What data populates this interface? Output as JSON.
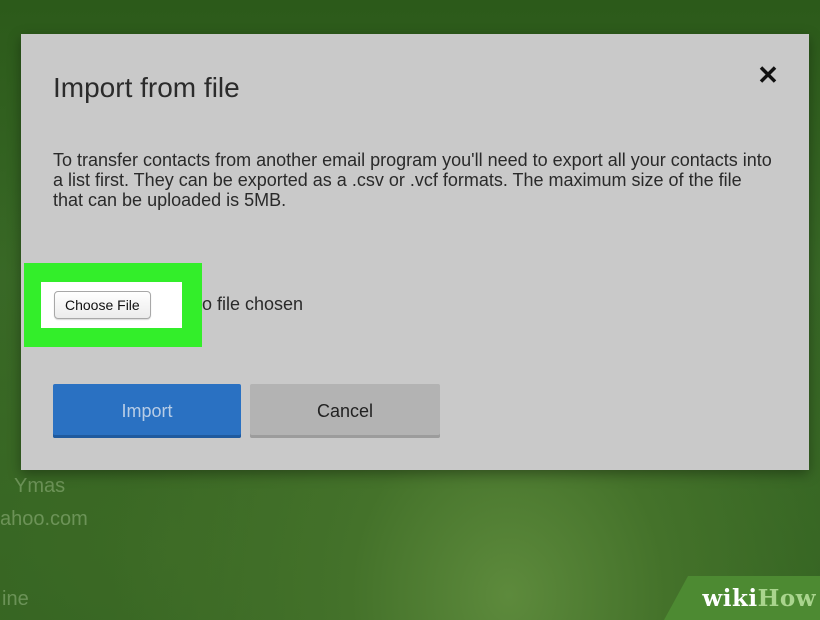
{
  "background": {
    "faint_lines": [
      "Ymas",
      "ahoo.com",
      "ine"
    ]
  },
  "watermark": {
    "part1": "wiki",
    "part2": "How"
  },
  "dialog": {
    "title": "Import from file",
    "close_icon": "close-icon",
    "close_glyph": "✕",
    "description": "To transfer contacts from another email program you'll need to export all your contacts into a list first. They can be exported as a .csv or .vcf formats. The maximum size of the file that can be uploaded is 5MB.",
    "file_input": {
      "button_label": "Choose File",
      "status_text": "o file chosen"
    },
    "buttons": {
      "import_label": "Import",
      "cancel_label": "Cancel"
    }
  },
  "colors": {
    "highlight": "#33ee2a",
    "primary": "#2a71c2",
    "dialog_bg": "#c9c9c9"
  }
}
